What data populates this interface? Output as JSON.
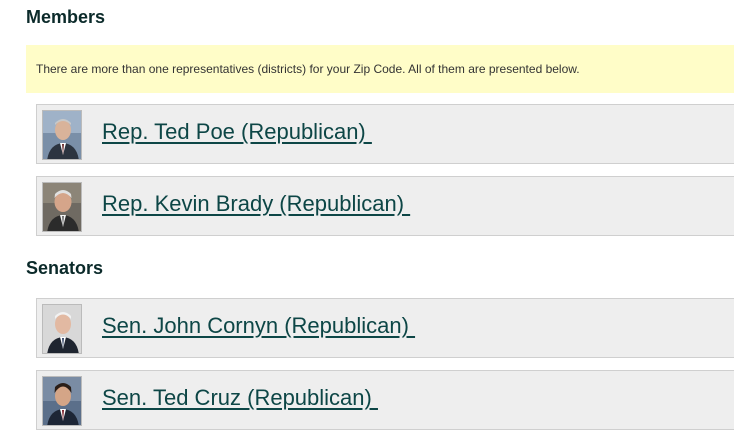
{
  "members": {
    "heading": "Members",
    "notice": "There are more than one representatives (districts) for your Zip Code. All of them are presented below.",
    "items": [
      {
        "name": "Rep. Ted Poe (Republican) "
      },
      {
        "name": "Rep. Kevin Brady (Republican) "
      }
    ]
  },
  "senators": {
    "heading": "Senators",
    "items": [
      {
        "name": "Sen. John Cornyn (Republican) "
      },
      {
        "name": "Sen. Ted Cruz (Republican) "
      }
    ]
  },
  "colors": {
    "heading": "#0b2a2a",
    "link": "#0d4646",
    "notice_bg": "#fffdc8",
    "card_bg": "#eeeeee"
  }
}
